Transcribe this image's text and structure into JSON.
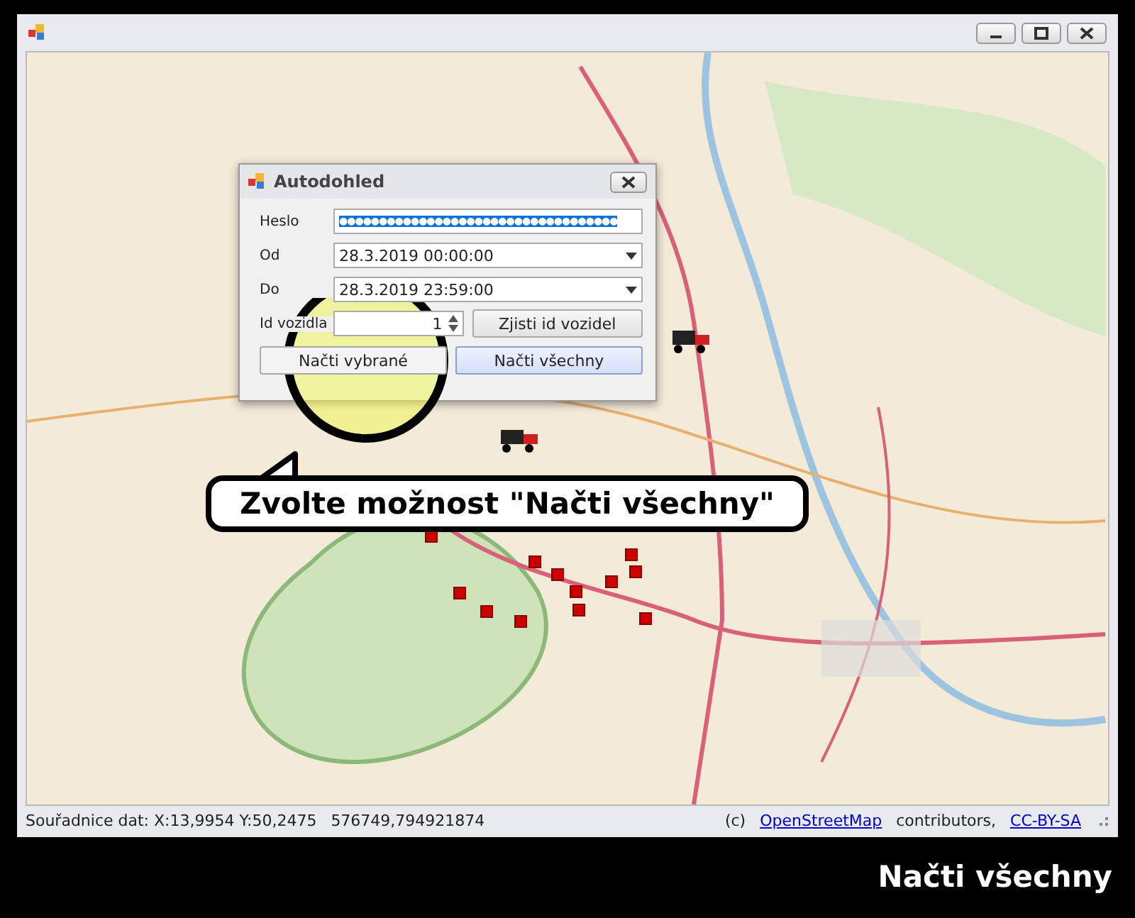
{
  "dialog": {
    "title": "Autodohled",
    "fields": [
      {
        "label": "Heslo",
        "kind": "password",
        "value": "●●●●●●●●●●●●●●●●●●●●●●●●●●●●●●●●●●●",
        "selected": true
      },
      {
        "label": "Od",
        "kind": "dropdown",
        "value": "28.3.2019 00:00:00",
        "selected": false
      },
      {
        "label": "Do",
        "kind": "dropdown",
        "value": "28.3.2019 23:59:00",
        "selected": false
      },
      {
        "label": "Id vozidla",
        "kind": "spinner",
        "value": "1",
        "selected": false
      }
    ],
    "buttons": [
      {
        "label": "Zjisti id vozidel",
        "focused": false
      },
      {
        "label": "Načti vybrané",
        "focused": false
      },
      {
        "label": "Načti všechny",
        "focused": true
      }
    ]
  },
  "status_bar": {
    "coordinates": "Souřadnice dat: X:13,9954 Y:50,2475",
    "value": "576749,794921874",
    "copyright": "(c)",
    "map_link": "OpenStreetMap",
    "contributors": "contributors,",
    "license_link": "CC-BY-SA"
  },
  "callout": "Zvolte možnost \"Načti všechny\"",
  "caption": "Načti všechny"
}
